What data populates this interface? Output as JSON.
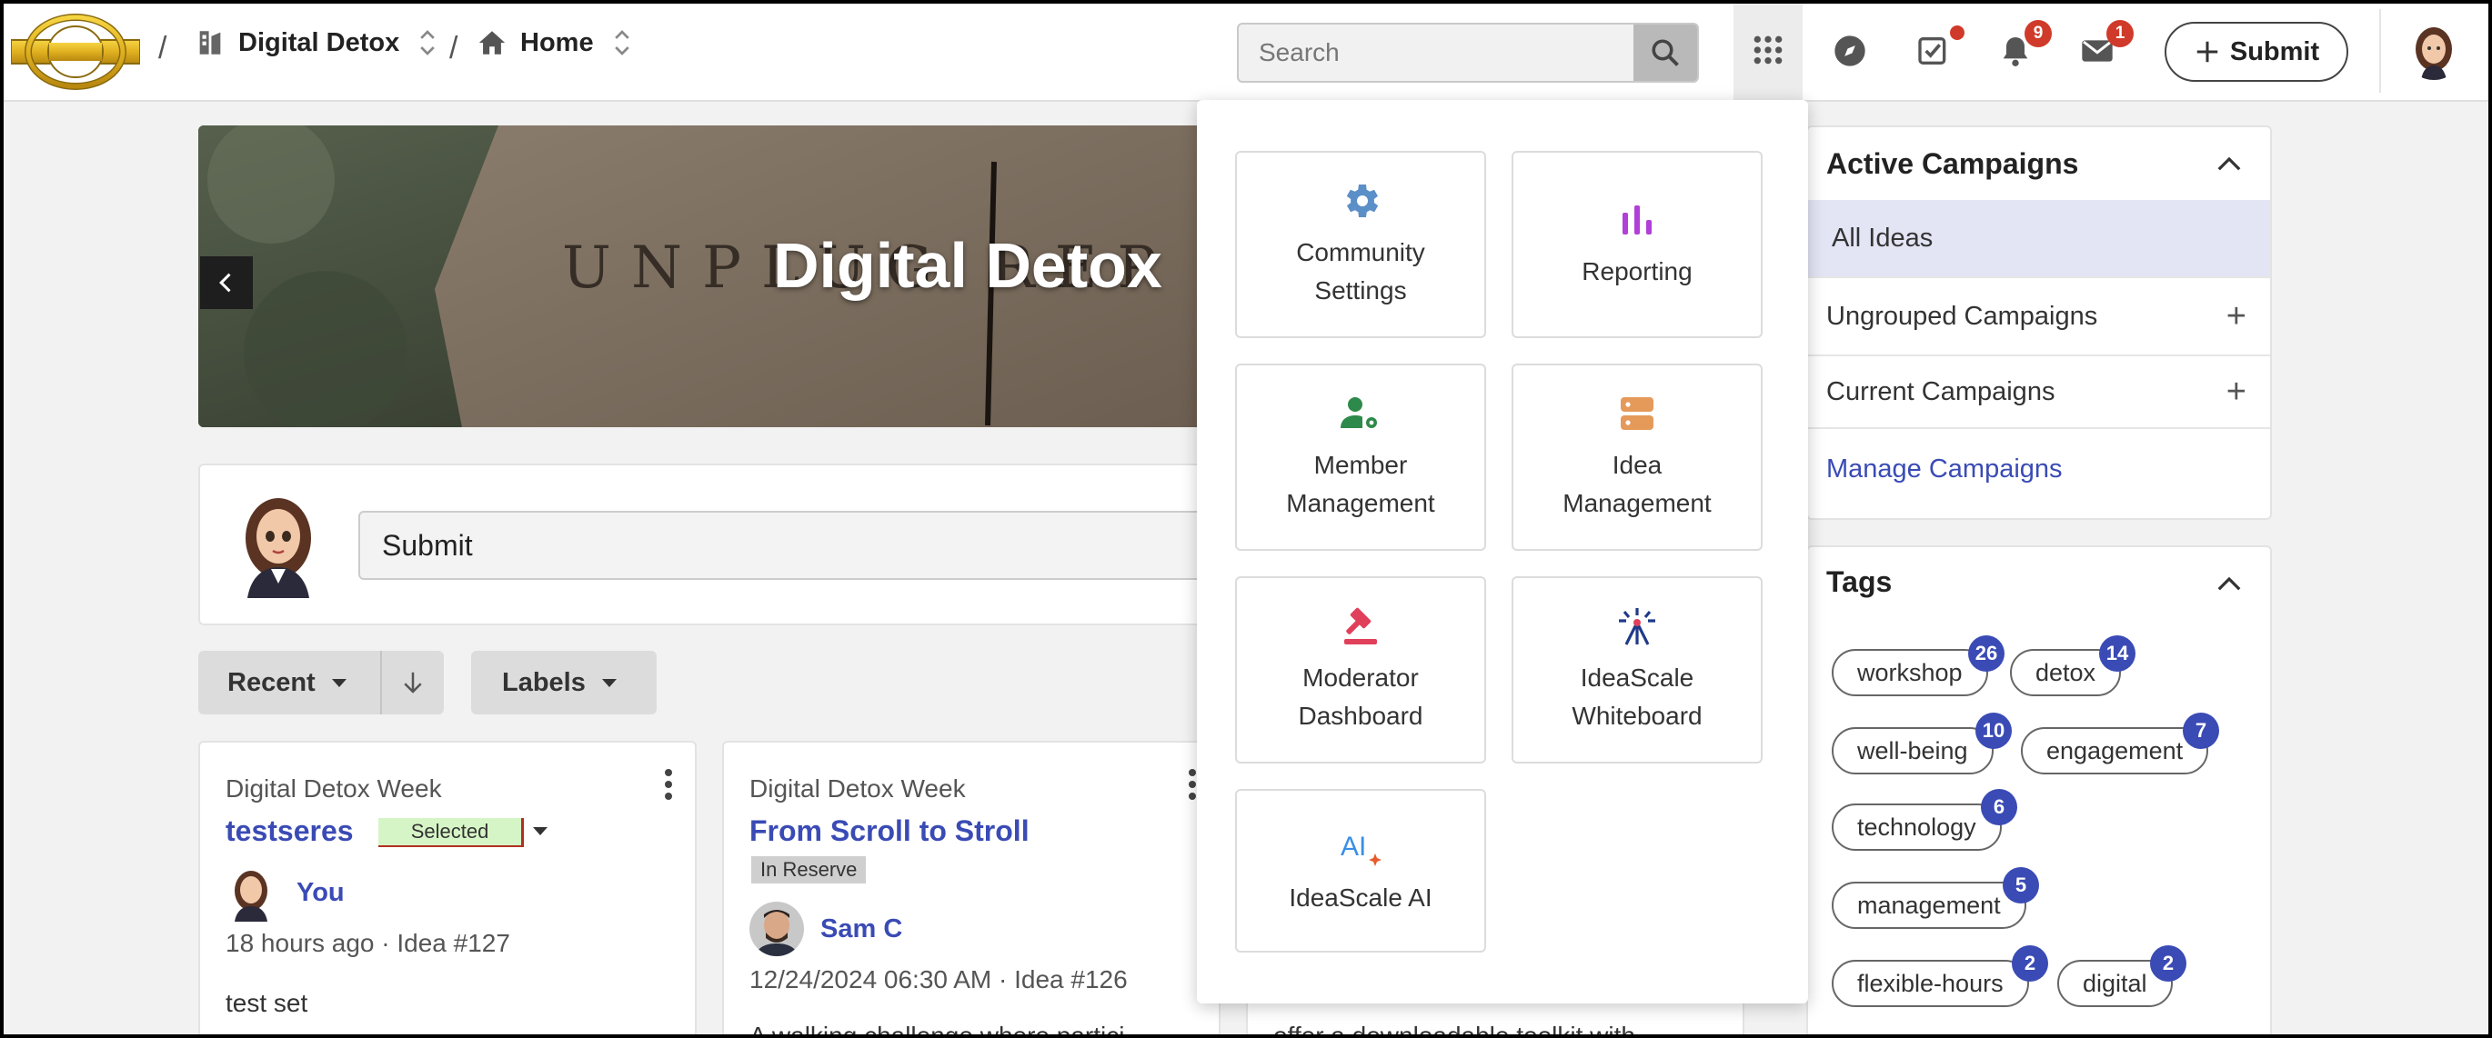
{
  "header": {
    "breadcrumb": [
      {
        "label": "Digital Detox",
        "icon": "community-icon"
      },
      {
        "label": "Home",
        "icon": "home-icon"
      }
    ],
    "search": {
      "placeholder": "Search",
      "value": ""
    },
    "badges": {
      "notifications": "9",
      "messages": "1"
    },
    "submit_label": "Submit"
  },
  "banner": {
    "title": "Digital Detox",
    "engraved_text": "UNPLUG REP"
  },
  "submit_card": {
    "placeholder": "Submit"
  },
  "filters": {
    "sort_label": "Recent",
    "labels_label": "Labels"
  },
  "ideas": [
    {
      "campaign": "Digital Detox Week",
      "title": "testseres",
      "status": "Selected",
      "author": "You",
      "meta": "18 hours ago · Idea #127",
      "excerpt": "test set"
    },
    {
      "campaign": "Digital Detox Week",
      "title": "From Scroll to Stroll",
      "status": "In Reserve",
      "author": "Sam C",
      "meta": "12/24/2024 06:30 AM · Idea #126",
      "excerpt": "A walking challenge where partici"
    },
    {
      "excerpt": "offer a downloadable toolkit with"
    }
  ],
  "apps_menu": [
    {
      "label": "Community\nSettings",
      "icon": "gear-icon",
      "color": "#5b8fc8"
    },
    {
      "label": "Reporting",
      "icon": "bar-chart-icon",
      "color": "#b040d8"
    },
    {
      "label": "Member\nManagement",
      "icon": "member-settings-icon",
      "color": "#2e8a4a"
    },
    {
      "label": "Idea\nManagement",
      "icon": "idea-server-icon",
      "color": "#e59a5a"
    },
    {
      "label": "Moderator\nDashboard",
      "icon": "gavel-icon",
      "color": "#e0405a"
    },
    {
      "label": "IdeaScale\nWhiteboard",
      "icon": "whiteboard-icon",
      "color": "#1f3a8a"
    },
    {
      "label": "IdeaScale AI",
      "icon": "ai-sparkle-icon",
      "color": "#3a8ee6"
    }
  ],
  "active_campaigns": {
    "title": "Active Campaigns",
    "items": [
      {
        "label": "All Ideas",
        "selected": true
      },
      {
        "label": "Ungrouped Campaigns",
        "expandable": true
      },
      {
        "label": "Current Campaigns",
        "expandable": true
      }
    ],
    "manage_link": "Manage Campaigns"
  },
  "tags": {
    "title": "Tags",
    "items": [
      {
        "label": "workshop",
        "count": "26"
      },
      {
        "label": "detox",
        "count": "14"
      },
      {
        "label": "well-being",
        "count": "10"
      },
      {
        "label": "engagement",
        "count": "7"
      },
      {
        "label": "technology",
        "count": "6"
      },
      {
        "label": "management",
        "count": "5"
      },
      {
        "label": "flexible-hours",
        "count": "2"
      },
      {
        "label": "digital",
        "count": "2"
      }
    ]
  },
  "colors": {
    "accent": "#3a4bb5",
    "badge": "#d03a2a",
    "selected_row": "#e3e5f5",
    "selected_status_bg": "#d6f5c6",
    "selected_status_border": "#b03020",
    "reserve_status_bg": "#cfcfcf"
  }
}
